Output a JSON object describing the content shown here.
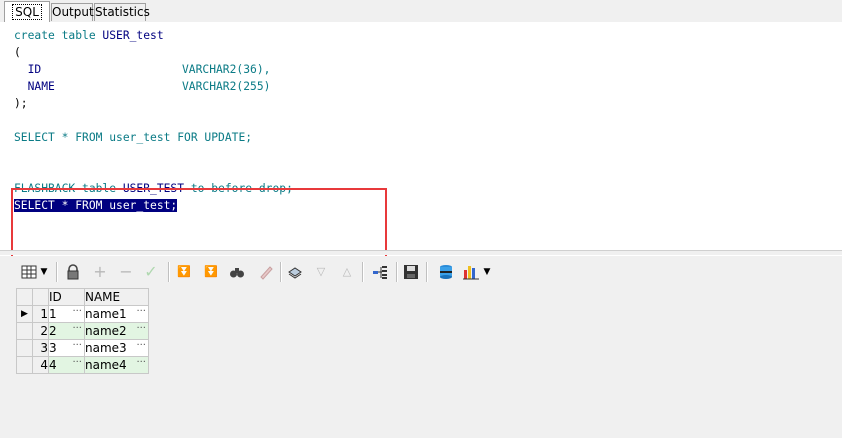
{
  "tabs": [
    {
      "label": "SQL",
      "active": true
    },
    {
      "label": "Output",
      "active": false
    },
    {
      "label": "Statistics",
      "active": false
    }
  ],
  "editor": {
    "lines": [
      {
        "kw1": "create table ",
        "id1": "USER_test"
      },
      {
        "text": "("
      },
      {
        "col": "  ID",
        "type": "VARCHAR2(36),"
      },
      {
        "col": "  NAME",
        "type": "VARCHAR2(255)"
      },
      {
        "text": ");"
      },
      {
        "text": ""
      },
      {
        "text": "SELECT * FROM user_test FOR UPDATE;"
      },
      {
        "text": ""
      },
      {
        "text": ""
      },
      {
        "kw1": "FLASHBACK table ",
        "id1": "USER_TEST",
        "kw2": " to before drop;"
      },
      {
        "selected": "SELECT * FROM user_test;"
      }
    ]
  },
  "toolbar": {
    "icons": [
      "grid-layout-icon",
      "dropdown-arrow-icon",
      "lock-icon",
      "add-record-icon",
      "delete-record-icon",
      "post-changes-icon",
      "fetch-next-icon",
      "fetch-last-icon",
      "find-icon",
      "clear-icon",
      "query-by-example-icon",
      "previous-query-icon",
      "next-query-icon",
      "record-view-icon",
      "save-icon",
      "export-icon",
      "chart-icon",
      "dropdown-arrow-icon"
    ]
  },
  "grid": {
    "columns": [
      "ID",
      "NAME"
    ],
    "rows": [
      {
        "num": "1",
        "id": "1",
        "name": "name1",
        "current": true
      },
      {
        "num": "2",
        "id": "2",
        "name": "name2",
        "current": false
      },
      {
        "num": "3",
        "id": "3",
        "name": "name3",
        "current": false
      },
      {
        "num": "4",
        "id": "4",
        "name": "name4",
        "current": false
      }
    ],
    "ellipsis": "···",
    "current_marker": "▶"
  }
}
